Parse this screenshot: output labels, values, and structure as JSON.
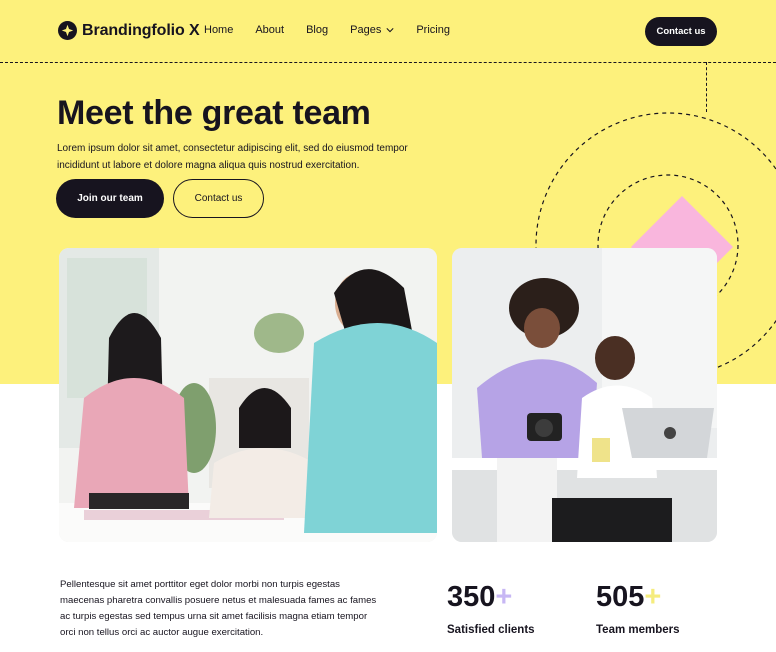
{
  "brand": {
    "name": "Brandingfolio X"
  },
  "nav": {
    "items": [
      {
        "label": "Home"
      },
      {
        "label": "About"
      },
      {
        "label": "Blog"
      },
      {
        "label": "Pages"
      },
      {
        "label": "Pricing"
      }
    ],
    "cta": "Contact us"
  },
  "hero": {
    "title": "Meet the great team",
    "subtitle": "Lorem ipsum dolor sit amet, consectetur adipiscing elit, sed do eiusmod tempor incididunt ut labore et dolore magna aliqua quis nostrud exercitation.",
    "primary_button": "Join our team",
    "secondary_button": "Contact us"
  },
  "body_text": "Pellentesque sit amet porttitor eget dolor morbi non turpis egestas maecenas pharetra convallis posuere netus et malesuada fames ac fames ac turpis egestas sed tempus urna sit amet facilisis magna etiam tempor orci non tellus orci ac auctor augue exercitation.",
  "stats": [
    {
      "value": "350",
      "suffix": "+",
      "label": "Satisfied clients",
      "accent": "#c7b7f4"
    },
    {
      "value": "505",
      "suffix": "+",
      "label": "Team members",
      "accent": "#f5ec7d"
    }
  ],
  "colors": {
    "hero_bg": "#fdf17c",
    "dark": "#17141f",
    "pink": "#f9b6dd"
  },
  "icons": {
    "logo": "star-badge-icon",
    "dropdown": "chevron-down-icon"
  }
}
